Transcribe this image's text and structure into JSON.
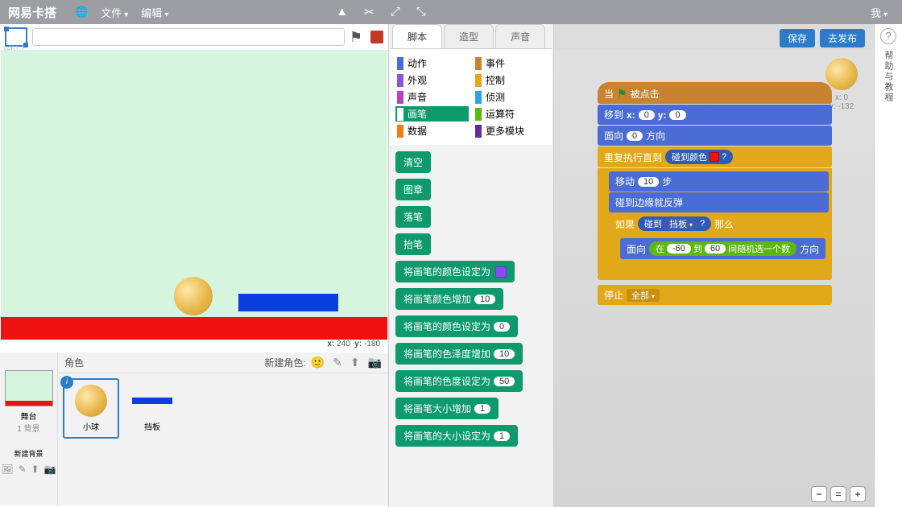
{
  "topbar": {
    "brand": "网易卡搭",
    "file": "文件",
    "edit": "编辑",
    "me": "我"
  },
  "topbtns": {
    "save": "保存",
    "publish": "去发布"
  },
  "stageHeader": {
    "version": "v461.1"
  },
  "coords": {
    "x_label": "x:",
    "x": "240",
    "y_label": "y:",
    "y": "-180"
  },
  "backdrop": {
    "stage": "舞台",
    "count": "1 背景",
    "newBackdrop": "新建背景"
  },
  "spritePanel": {
    "label": "角色",
    "newSprite": "新建角色:",
    "ball": "小球",
    "paddle": "挡板"
  },
  "tabs": {
    "scripts": "脚本",
    "costumes": "造型",
    "sounds": "声音"
  },
  "cats": {
    "motion": "动作",
    "events": "事件",
    "looks": "外观",
    "control": "控制",
    "sound": "声音",
    "sensing": "侦测",
    "pen": "画笔",
    "operators": "运算符",
    "data": "数据",
    "more": "更多模块"
  },
  "penBlocks": {
    "clear": "清空",
    "stamp": "图章",
    "penDown": "落笔",
    "penUp": "抬笔",
    "setColor": "将画笔的颜色设定为",
    "changeColor": "将画笔颜色增加",
    "changeColorV": "10",
    "setColorN": "将画笔的颜色设定为",
    "setColorNV": "0",
    "changeShade": "将画笔的色泽度增加",
    "changeShadeV": "10",
    "setShade": "将画笔的色度设定为",
    "setShadeV": "50",
    "changeSize": "将画笔大小增加",
    "changeSizeV": "1",
    "setSize": "将画笔的大小设定为",
    "setSizeV": "1"
  },
  "script": {
    "when": "当",
    "clicked": "被点击",
    "goto": "移到",
    "x": "x:",
    "xV": "0",
    "y": "y:",
    "yV": "0",
    "point": "面向",
    "pointV": "0",
    "dir": "方向",
    "repeatUntil": "重复执行直到",
    "touchColor": "碰到颜色",
    "q": "?",
    "move": "移动",
    "moveV": "10",
    "steps": "步",
    "bounce": "碰到边缘就反弹",
    "if": "如果",
    "touching": "碰到",
    "touchingV": "挡板",
    "then": "那么",
    "point2": "面向",
    "between": "在",
    "minV": "-60",
    "to": "到",
    "maxV": "60",
    "pickRandom": "间随机选一个数",
    "dir2": "方向",
    "stop": "停止",
    "stopV": "全部"
  },
  "preview": {
    "x_label": "x:",
    "x": "0",
    "y_label": "y:",
    "y": "-132"
  },
  "help": "帮助与教程"
}
